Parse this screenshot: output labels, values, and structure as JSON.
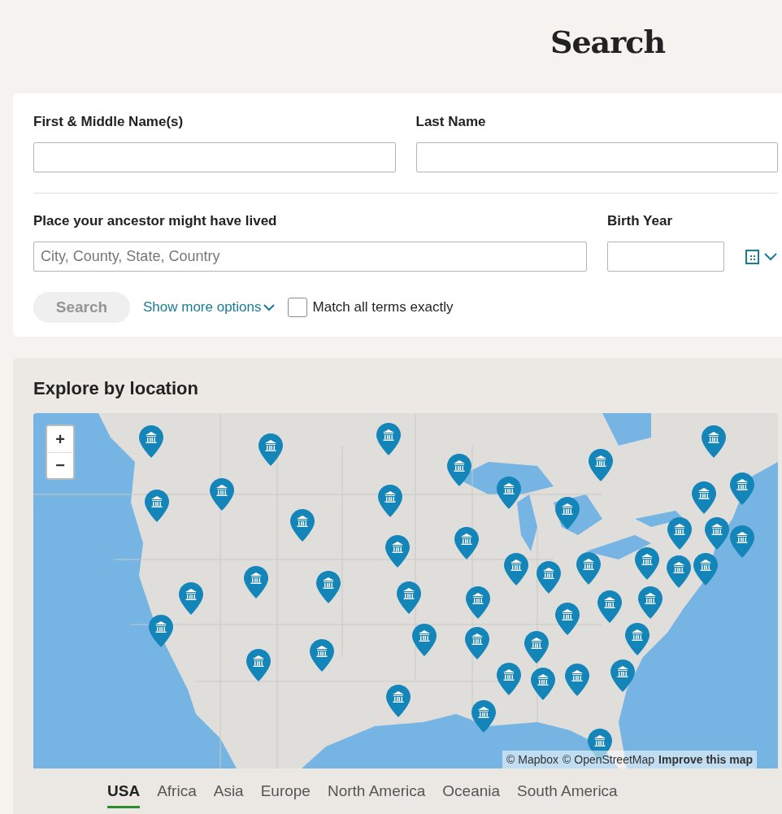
{
  "page_title": "Search",
  "form": {
    "rows": [
      {
        "fields": [
          {
            "kind": "text",
            "label": "First & Middle Name(s)"
          },
          {
            "kind": "text",
            "label": "Last Name"
          }
        ]
      },
      {
        "fields": [
          {
            "kind": "text",
            "label": "Place your ancestor might have lived",
            "placeholder": "City, County, State, Country"
          },
          {
            "kind": "year",
            "label": "Birth Year"
          }
        ]
      }
    ],
    "search_button": {
      "label": "Search",
      "disabled": true
    },
    "more_options": "Show more options",
    "exact_match": {
      "label": "Match all terms exactly",
      "checked": false
    }
  },
  "explore": {
    "heading": "Explore by location",
    "map": {
      "zoom_in": "+",
      "zoom_out": "−",
      "attribution": [
        {
          "text": "© Mapbox",
          "kind": "text"
        },
        {
          "text": "© OpenStreetMap",
          "kind": "text"
        },
        {
          "text": "Improve this map",
          "kind": "link"
        }
      ]
    },
    "tabs": [
      {
        "label": "USA",
        "selected": true
      },
      {
        "label": "Africa",
        "selected": false
      },
      {
        "label": "Asia",
        "selected": false
      },
      {
        "label": "Europe",
        "selected": false
      },
      {
        "label": "North America",
        "selected": false
      },
      {
        "label": "Oceania",
        "selected": false
      },
      {
        "label": "South America",
        "selected": false
      }
    ]
  }
}
